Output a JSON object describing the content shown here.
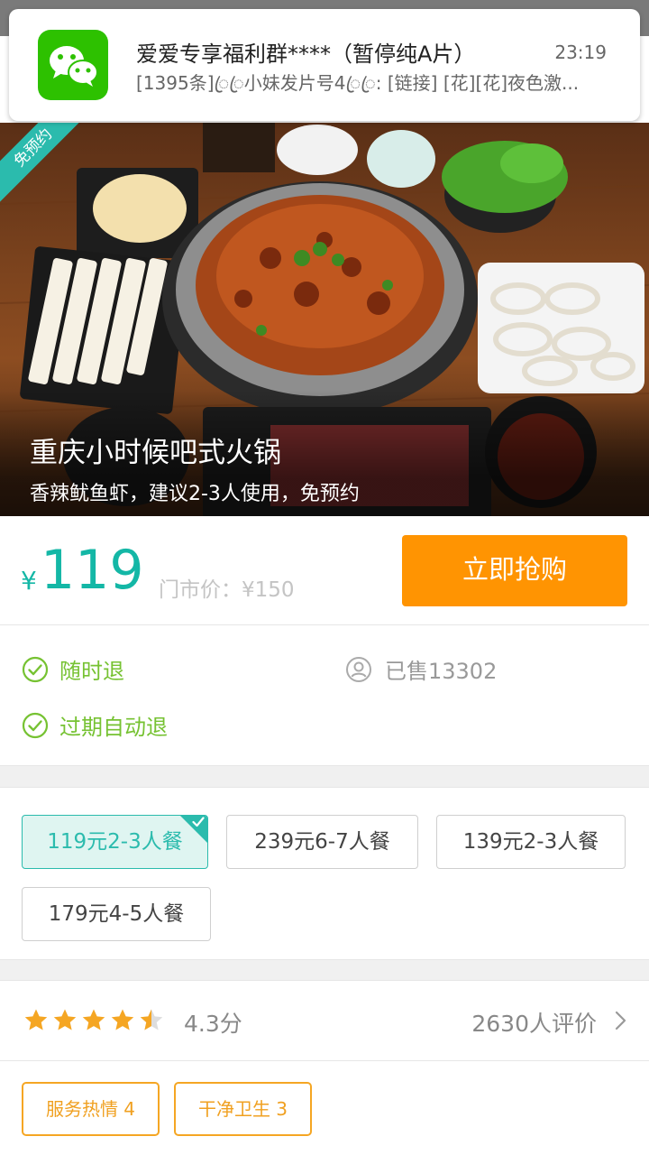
{
  "notification": {
    "app_icon": "wechat-icon",
    "title": "爱爱专享福利群****（暂停纯A片）",
    "time": "23:19",
    "message": "[1395条]ꦿꦿ小妹发片号4ꦿꦿ: [链接] [花][花]夜色激..."
  },
  "deal": {
    "badge": "免预约",
    "title": "重庆小时候吧式火锅",
    "subtitle": "香辣鱿鱼虾，建议2-3人使用，免预约",
    "currency": "¥",
    "price": "119",
    "original_price": "门市价：¥150",
    "buy_label": "立即抢购"
  },
  "features": {
    "refund_anytime": "随时退",
    "auto_refund": "过期自动退",
    "sold": "已售13302",
    "accent_color": "#76c232"
  },
  "options": [
    {
      "label": "119元2-3人餐",
      "selected": true
    },
    {
      "label": "239元6-7人餐",
      "selected": false
    },
    {
      "label": "139元2-3人餐",
      "selected": false
    },
    {
      "label": "179元4-5人餐",
      "selected": false
    }
  ],
  "rating": {
    "stars": 4.3,
    "max_stars": 5,
    "score": "4.3分",
    "reviews": "2630人评价"
  },
  "tags": [
    {
      "label": "服务热情 4"
    },
    {
      "label": "干净卫生 3"
    }
  ],
  "colors": {
    "brand_teal": "#14b7a6",
    "buy_orange": "#ff9402",
    "star": "#f5a623"
  }
}
